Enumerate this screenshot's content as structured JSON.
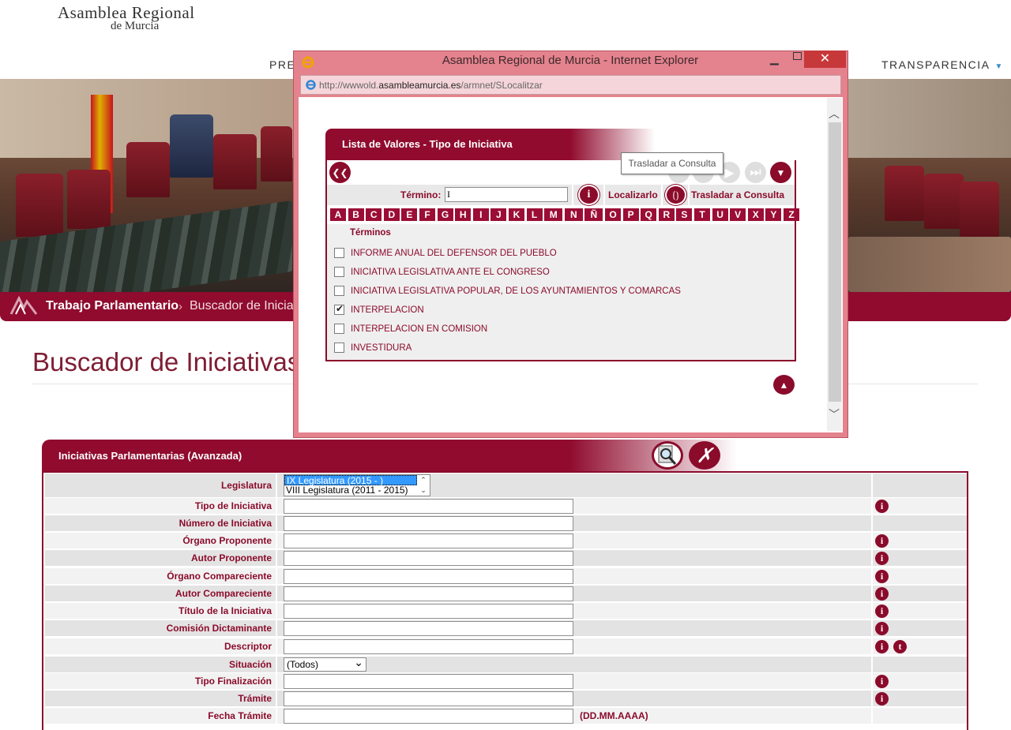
{
  "header": {
    "logo_line1": "Asamblea Regional",
    "logo_line2": "de Murcia",
    "nav_left_partial": "PRES",
    "nav_right": "TRANSPARENCIA"
  },
  "breadcrumb": {
    "section": "Trabajo Parlamentario",
    "separator": "›",
    "current": "Buscador de Iniciat"
  },
  "page_title": "Buscador de Iniciativas",
  "form": {
    "title": "Iniciativas Parlamentarias (Avanzada)",
    "legislatura_label": "Legislatura",
    "legislatura_options": [
      "IX Legislatura (2015 - )",
      "VIII Legislatura (2011 - 2015)"
    ],
    "rows": [
      {
        "label": "Tipo de Iniciativa",
        "value": ""
      },
      {
        "label": "Número de Iniciativa",
        "value": ""
      },
      {
        "label": "Órgano Proponente",
        "value": ""
      },
      {
        "label": "Autor Proponente",
        "value": ""
      },
      {
        "label": "Órgano Compareciente",
        "value": ""
      },
      {
        "label": "Autor Compareciente",
        "value": ""
      },
      {
        "label": "Título de la Iniciativa",
        "value": ""
      },
      {
        "label": "Comisión Dictaminante",
        "value": ""
      },
      {
        "label": "Descriptor",
        "value": ""
      },
      {
        "label": "Situación",
        "value": "(Todos)"
      },
      {
        "label": "Tipo Finalización",
        "value": ""
      },
      {
        "label": "Trámite",
        "value": ""
      },
      {
        "label": "Fecha Trámite",
        "value": "",
        "hint": "(DD.MM.AAAA)"
      }
    ],
    "info_icon_glyph": "i",
    "tree_icon_glyph": "t"
  },
  "popup": {
    "window_title": "Asamblea Regional de Murcia - Internet Explorer",
    "url_prefix": "http://wwwold.",
    "url_domain": "asambleamurcia.es",
    "url_path": "/armnet/SLocalitzar",
    "list_title": "Lista de Valores - Tipo de Iniciativa",
    "termino_label": "Término:",
    "termino_value": "I",
    "localizar_label": "Localizarlo",
    "trasladar_label": "Trasladar a Consulta",
    "tooltip": "Trasladar a Consulta",
    "alphabet": [
      "A",
      "B",
      "C",
      "D",
      "E",
      "F",
      "G",
      "H",
      "I",
      "J",
      "K",
      "L",
      "M",
      "N",
      "Ñ",
      "O",
      "P",
      "Q",
      "R",
      "S",
      "T",
      "U",
      "V",
      "X",
      "Y",
      "Z"
    ],
    "terms_header": "Términos",
    "terms": [
      {
        "label": "INFORME ANUAL DEL DEFENSOR DEL PUEBLO",
        "checked": false
      },
      {
        "label": "INICIATIVA LEGISLATIVA ANTE EL CONGRESO",
        "checked": false
      },
      {
        "label": "INICIATIVA LEGISLATIVA POPULAR, DE LOS AYUNTAMIENTOS Y COMARCAS",
        "checked": false
      },
      {
        "label": "INTERPELACION",
        "checked": true
      },
      {
        "label": "INTERPELACION EN COMISION",
        "checked": false
      },
      {
        "label": "INVESTIDURA",
        "checked": false
      }
    ]
  }
}
